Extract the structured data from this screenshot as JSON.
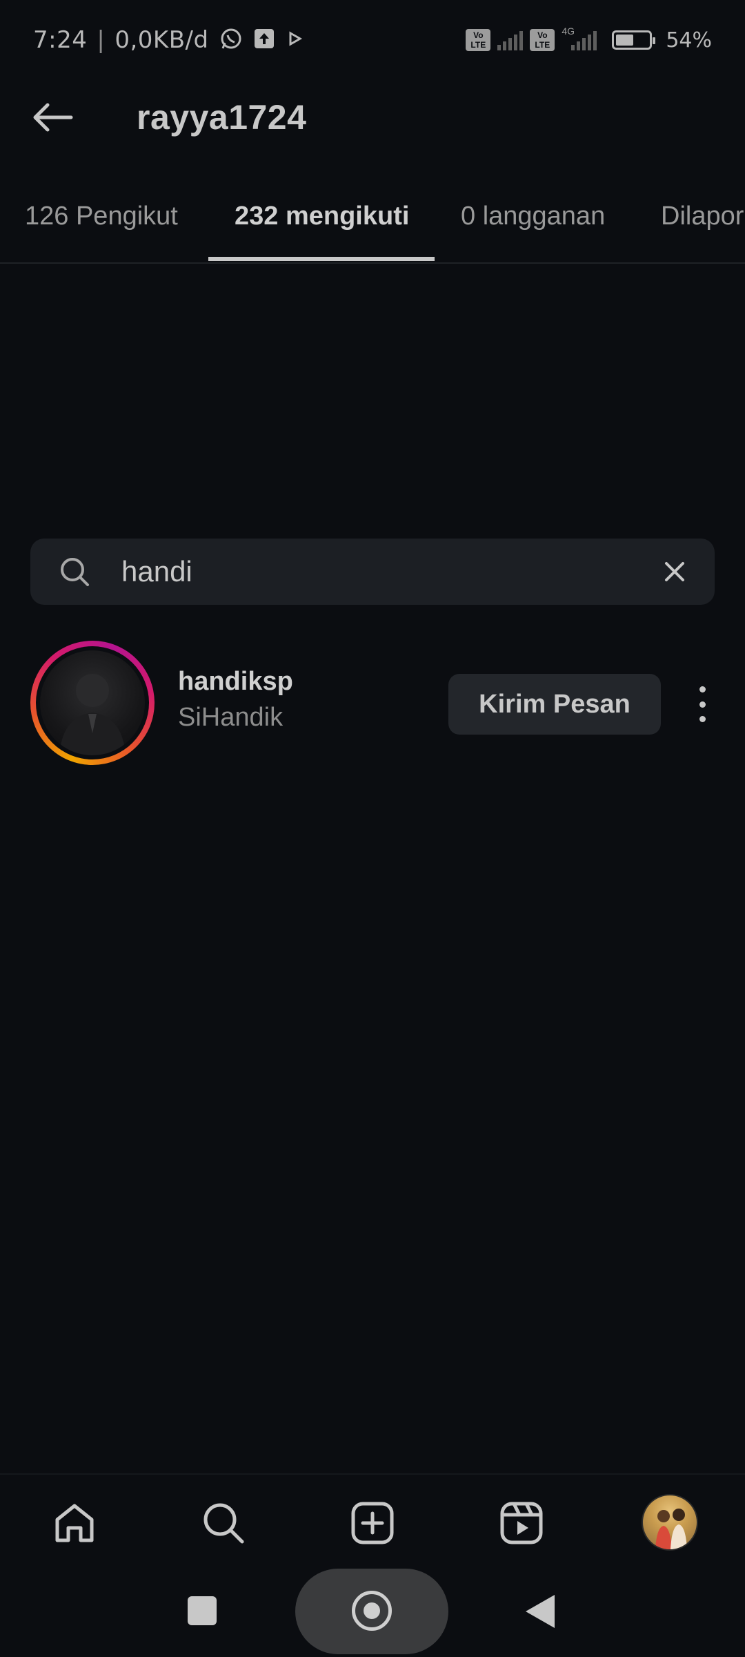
{
  "status_bar": {
    "time": "7:24",
    "network_speed": "0,0KB/d",
    "icons": [
      "whatsapp-icon",
      "upload-icon",
      "play-icon",
      "volte-icon",
      "signal-icon",
      "volte-icon",
      "4g-signal-icon",
      "battery-icon"
    ],
    "volte_label": "Vo LTE",
    "network_type": "4G",
    "battery_percent": "54%",
    "battery_level": 0.54
  },
  "header": {
    "back_icon": "arrow-left-icon",
    "title": "rayya1724"
  },
  "tabs": [
    {
      "label": "126 Pengikut",
      "active": false
    },
    {
      "label": "232 mengikuti",
      "active": true
    },
    {
      "label": "0 langganan",
      "active": false
    },
    {
      "label": "Dilapor",
      "active": false
    }
  ],
  "search": {
    "icon": "search-icon",
    "value": "handi",
    "clear_icon": "close-icon"
  },
  "results": [
    {
      "username": "handiksp",
      "full_name": "SiHandik",
      "has_story_ring": true,
      "button_label": "Kirim Pesan",
      "more_icon": "more-vertical-icon"
    }
  ],
  "bottom_nav": {
    "items": [
      "home-icon",
      "search-icon",
      "create-post-icon",
      "reels-icon",
      "profile-avatar"
    ]
  },
  "system_nav": {
    "items": [
      "recent-apps-button",
      "home-button",
      "back-button"
    ]
  },
  "colors": {
    "background": "#0b0d11",
    "text_primary": "#c8c8c8",
    "text_secondary": "#8d8d8d",
    "surface": "#1c1f24",
    "button": "#23262b",
    "story_ring_start": "#f0a400",
    "story_ring_end": "#b5148f"
  }
}
